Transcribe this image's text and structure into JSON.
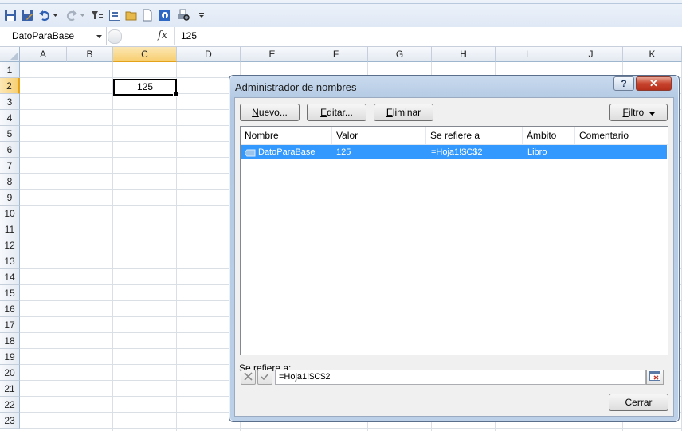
{
  "quick_access_toolbar": {
    "icons": [
      "save-icon",
      "save-as-icon",
      "undo-icon",
      "undo-dropdown-icon",
      "redo-icon",
      "redo-dropdown-icon",
      "sort-filter-icon",
      "form-icon",
      "open-icon",
      "new-icon",
      "info-icon",
      "print-preview-icon",
      "customize-toolbar-icon"
    ]
  },
  "formula_bar": {
    "name_box": "DatoParaBase",
    "fx_label": "fx",
    "content": "125"
  },
  "sheet": {
    "columns": [
      "A",
      "B",
      "C",
      "D",
      "E",
      "F",
      "G",
      "H",
      "I",
      "J",
      "K"
    ],
    "rows": [
      "1",
      "2",
      "3",
      "4",
      "5",
      "6",
      "7",
      "8",
      "9",
      "10",
      "11",
      "12",
      "13",
      "14",
      "15",
      "16",
      "17",
      "18",
      "19",
      "20",
      "21",
      "22",
      "23"
    ],
    "selected_column": "C",
    "selected_row": "2",
    "active_cell_value": "125"
  },
  "dialog": {
    "title": "Administrador de nombres",
    "help_label": "?",
    "close_label": "✕",
    "buttons": {
      "new": {
        "before": "",
        "mnemonic": "N",
        "after": "uevo..."
      },
      "edit": {
        "before": "",
        "mnemonic": "E",
        "after": "ditar..."
      },
      "delete": {
        "before": "",
        "mnemonic": "E",
        "after": "liminar"
      },
      "filter": {
        "before": "",
        "mnemonic": "F",
        "after": "iltro"
      }
    },
    "list": {
      "headers": [
        "Nombre",
        "Valor",
        "Se refiere a",
        "Ámbito",
        "Comentario"
      ],
      "rows": [
        {
          "name": "DatoParaBase",
          "value": "125",
          "refers_to": "=Hoja1!$C$2",
          "scope": "Libro",
          "comment": ""
        }
      ]
    },
    "refers_to_label": {
      "before": "Se refiere ",
      "mnemonic": "a",
      "after": ":"
    },
    "refers_to_value": "=Hoja1!$C$2",
    "close_button": "Cerrar",
    "colors": {
      "selection": "#3399ff",
      "frame": "#bcd0e8"
    }
  }
}
